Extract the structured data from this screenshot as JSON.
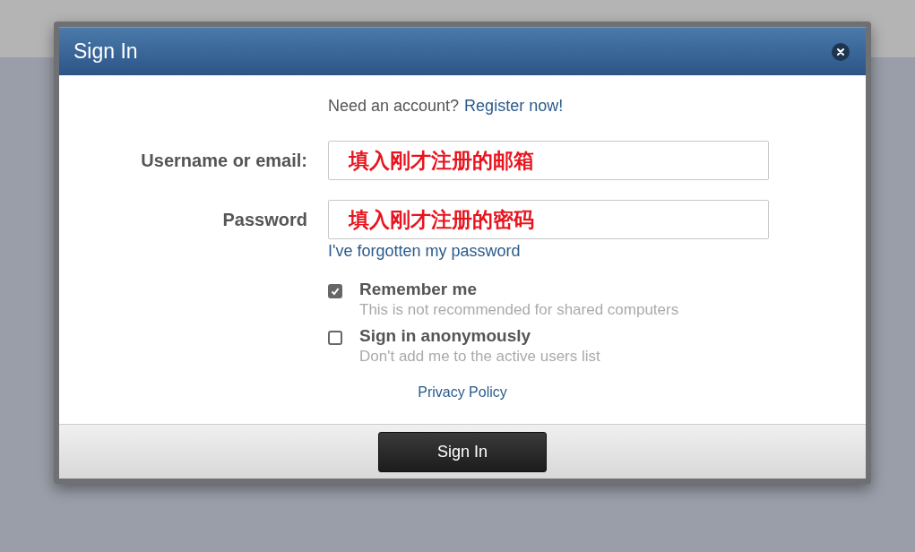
{
  "dialog": {
    "title": "Sign In",
    "register_prompt": {
      "text": "Need an account?",
      "link": "Register now!"
    },
    "fields": [
      {
        "label": "Username or email:",
        "value": "填入刚才注册的邮箱"
      },
      {
        "label": "Password",
        "value": "填入刚才注册的密码"
      }
    ],
    "forgot_link": "I've forgotten my password",
    "options": [
      {
        "label": "Remember me",
        "hint": "This is not recommended for shared computers",
        "checked": true
      },
      {
        "label": "Sign in anonymously",
        "hint": "Don't add me to the active users list",
        "checked": false
      }
    ],
    "privacy_link": "Privacy Policy",
    "submit_button": "Sign In"
  }
}
